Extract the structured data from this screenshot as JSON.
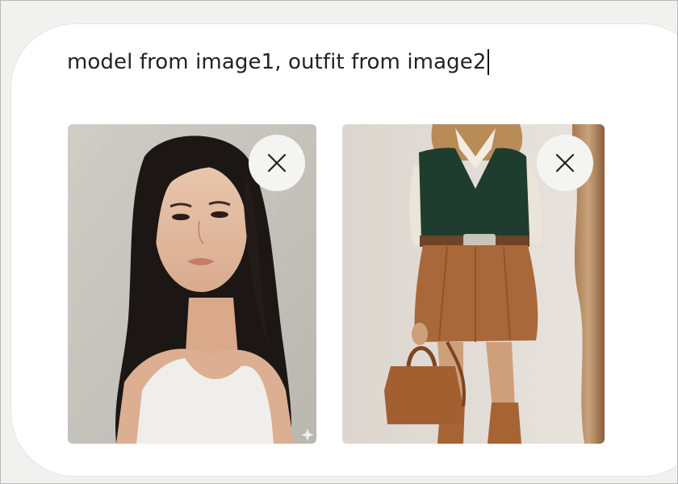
{
  "prompt": {
    "text": "model from image1, outfit from image2"
  },
  "attachments": [
    {
      "remove_icon": "close-icon"
    },
    {
      "remove_icon": "close-icon"
    }
  ],
  "colors": {
    "text": "#222222",
    "remove_button_bg": "#f4f4f2",
    "frame_bg": "#f1f1ef"
  }
}
